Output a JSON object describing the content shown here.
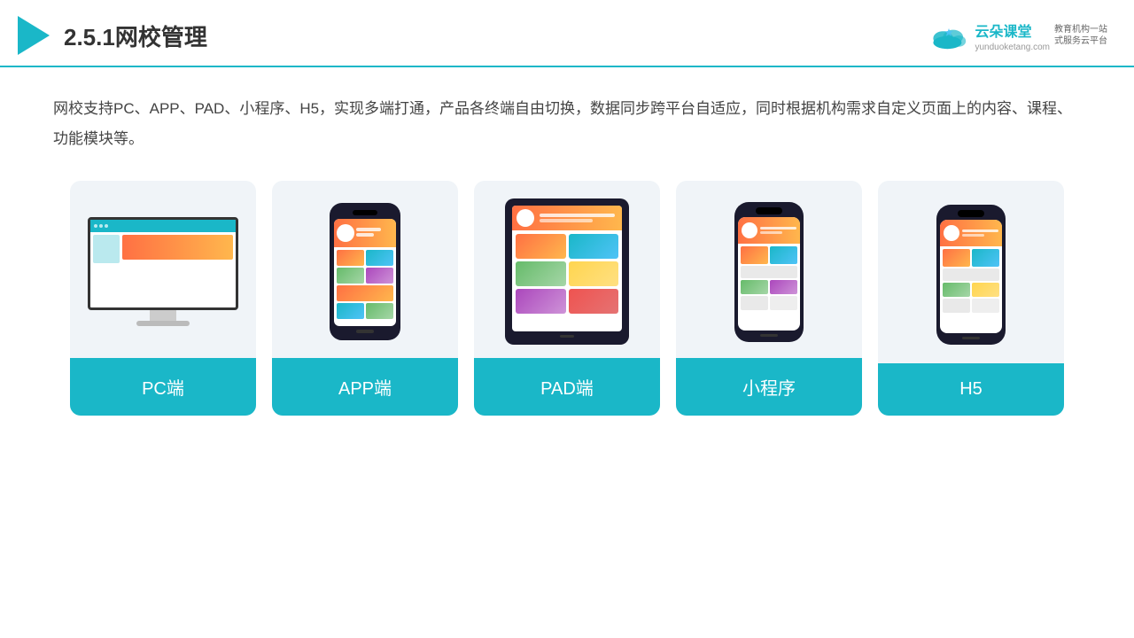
{
  "header": {
    "title": "2.5.1网校管理",
    "logo": {
      "name": "云朵课堂",
      "url": "yunduoketang.com",
      "tagline1": "教育机构一站",
      "tagline2": "式服务云平台"
    }
  },
  "description": {
    "text": "网校支持PC、APP、PAD、小程序、H5，实现多端打通，产品各终端自由切换，数据同步跨平台自适应，同时根据机构需求自定义页面上的内容、课程、功能模块等。"
  },
  "cards": [
    {
      "id": "pc",
      "label": "PC端"
    },
    {
      "id": "app",
      "label": "APP端"
    },
    {
      "id": "pad",
      "label": "PAD端"
    },
    {
      "id": "miniprogram",
      "label": "小程序"
    },
    {
      "id": "h5",
      "label": "H5"
    }
  ],
  "colors": {
    "accent": "#1ab7c8",
    "dark": "#333333",
    "cardBg": "#f0f4f8"
  }
}
